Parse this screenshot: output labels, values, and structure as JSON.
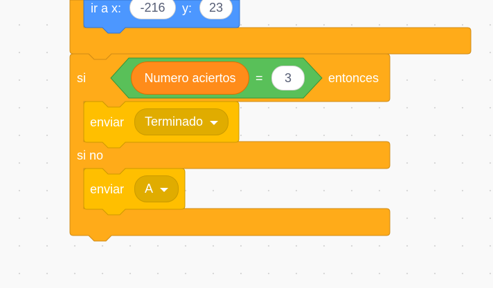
{
  "motion_block": {
    "label_go_to_x": "ir a x:",
    "x_value": "-216",
    "label_y": "y:",
    "y_value": "23"
  },
  "if_else_block": {
    "if_label": "si",
    "then_label": "entonces",
    "else_label": "si no",
    "condition": {
      "variable": "Numero aciertos",
      "operator": "=",
      "value": "3"
    }
  },
  "broadcast_blocks": [
    {
      "label": "enviar",
      "message": "Terminado"
    },
    {
      "label": "enviar",
      "message": "A"
    }
  ],
  "colors": {
    "control": "#ffab19",
    "control_border": "#cf8b17",
    "events": "#ffbf00",
    "events_border": "#cc9900",
    "operators": "#59c059",
    "operators_border": "#389438",
    "variables": "#ff8c1a",
    "motion": "#4c97ff",
    "motion_border": "#3373cc"
  }
}
